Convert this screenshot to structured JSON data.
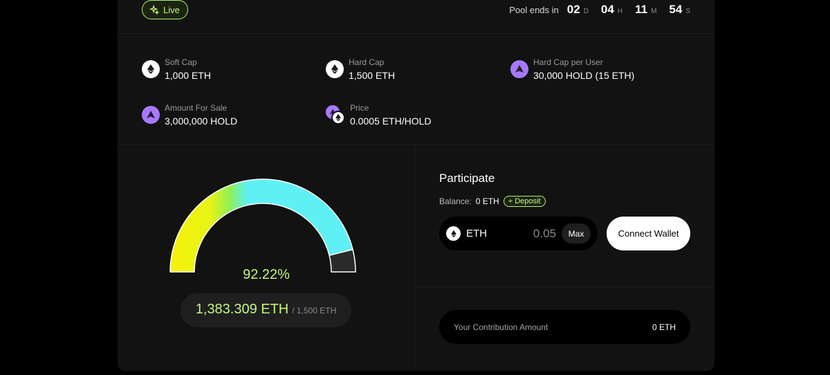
{
  "status": {
    "badge_label": "Live",
    "accent": "#c6f57f"
  },
  "timer": {
    "label": "Pool ends in",
    "days": "02",
    "days_unit": "D",
    "hours": "04",
    "hours_unit": "H",
    "minutes": "11",
    "minutes_unit": "M",
    "seconds": "54",
    "seconds_unit": "S"
  },
  "stats": [
    {
      "label": "Soft Cap",
      "value": "1,000 ETH",
      "icon": "eth-icon"
    },
    {
      "label": "Hard Cap",
      "value": "1,500 ETH",
      "icon": "eth-icon"
    },
    {
      "label": "Hard Cap per User",
      "value": "30,000 HOLD (15 ETH)",
      "icon": "hold-icon"
    },
    {
      "label": "Amount For Sale",
      "value": "3,000,000 HOLD",
      "icon": "hold-icon"
    },
    {
      "label": "Price",
      "value": "0.0005 ETH/HOLD",
      "icon": "hold-eth-pair-icon"
    }
  ],
  "progress": {
    "percent_label": "92.22%",
    "percent_value": 0.9222,
    "raised": "1,383.309 ETH",
    "goal": "/ 1,500 ETH"
  },
  "participate": {
    "title": "Participate",
    "balance_label": "Balance:",
    "balance_value": "0 ETH",
    "deposit_label": "+ Deposit",
    "currency": "ETH",
    "amount": "0.05",
    "max_label": "Max",
    "connect_label": "Connect Wallet"
  },
  "contribution": {
    "label": "Your Contribution Amount",
    "value": "0 ETH"
  }
}
